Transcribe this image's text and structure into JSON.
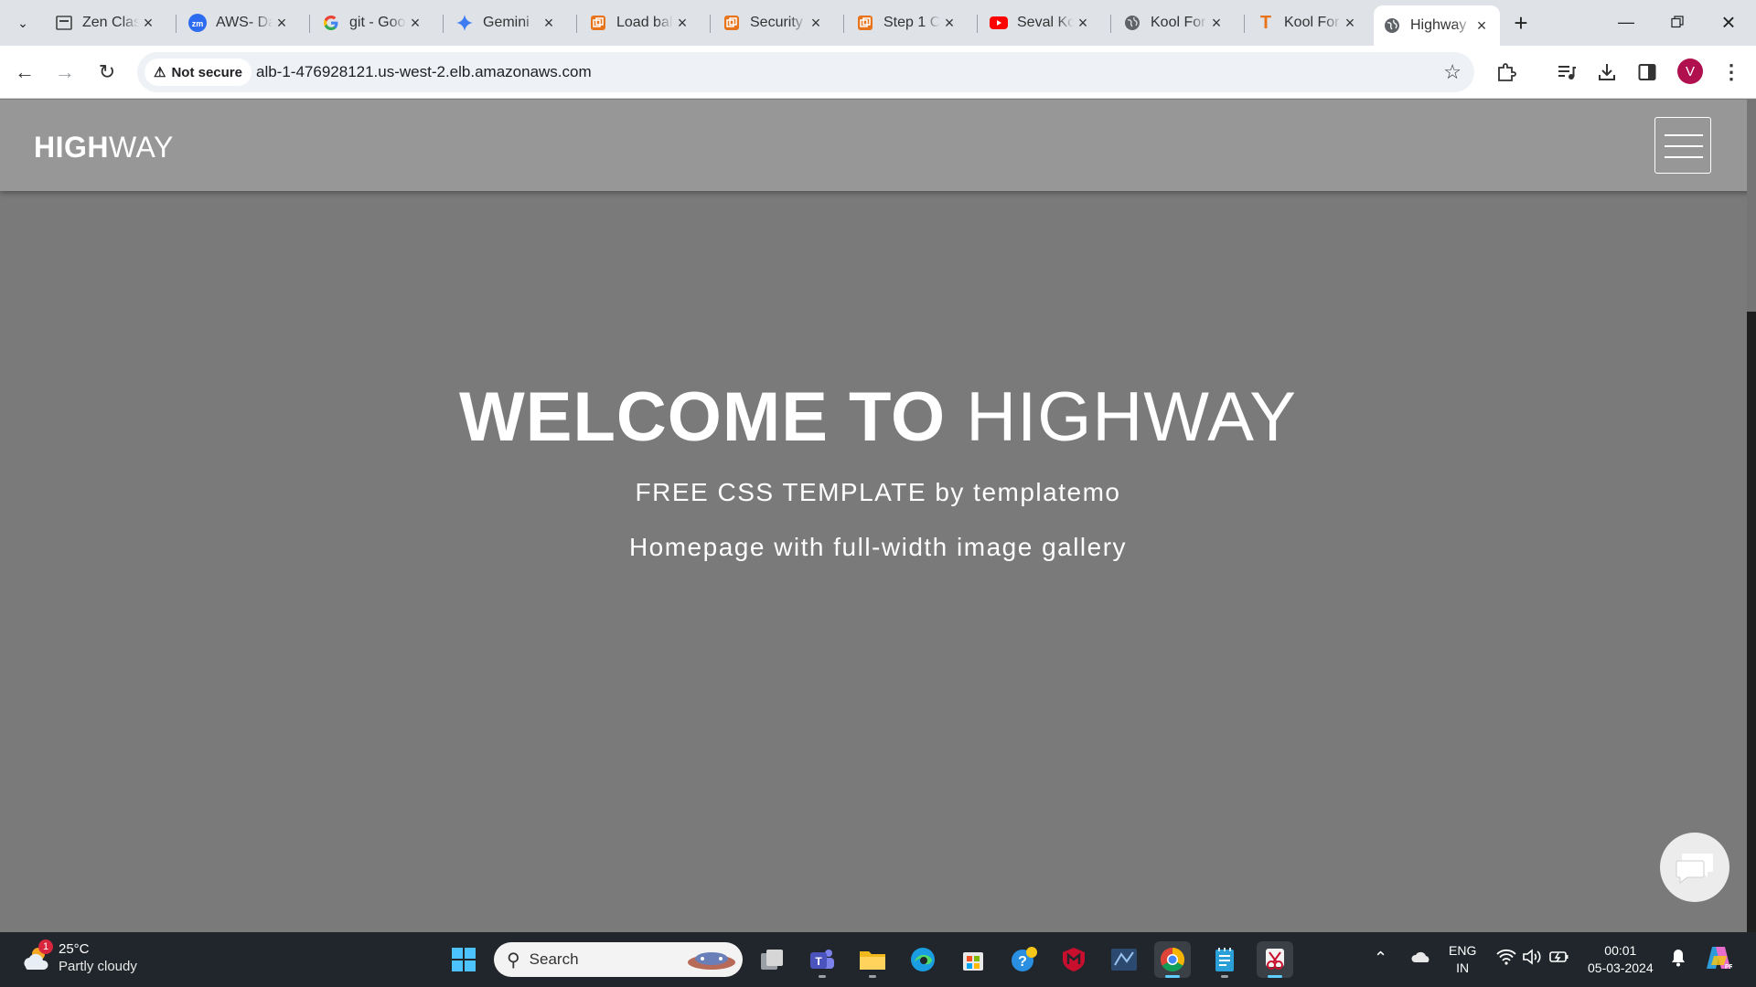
{
  "browser": {
    "tabs": [
      {
        "title": "Zen Class",
        "favicon": "zen-class-icon"
      },
      {
        "title": "AWS- Day",
        "favicon": "zoom-icon"
      },
      {
        "title": "git - Google",
        "favicon": "google-icon"
      },
      {
        "title": "Gemini",
        "favicon": "gemini-icon"
      },
      {
        "title": "Load balancers",
        "favicon": "aws-icon"
      },
      {
        "title": "Security",
        "favicon": "aws-icon"
      },
      {
        "title": "Step 1 C",
        "favicon": "aws-icon"
      },
      {
        "title": "Seval Ko",
        "favicon": "youtube-icon"
      },
      {
        "title": "Kool For",
        "favicon": "globe-icon"
      },
      {
        "title": "Kool For",
        "favicon": "t-icon"
      },
      {
        "title": "Highway",
        "favicon": "globe-icon",
        "active": true
      }
    ],
    "security_label": "Not secure",
    "url": "alb-1-476928121.us-west-2.elb.amazonaws.com",
    "profile_initial": "V"
  },
  "site": {
    "logo_bold": "HIGH",
    "logo_light": "WAY",
    "hero_bold": "WELCOME TO",
    "hero_light": "HIGHWAY",
    "subtitle": "FREE CSS TEMPLATE by templatemo",
    "tagline": "Homepage with full-width image gallery"
  },
  "taskbar": {
    "weather_temp": "25°C",
    "weather_desc": "Partly cloudy",
    "weather_badge": "1",
    "search_placeholder": "Search",
    "lang_line1": "ENG",
    "lang_line2": "IN",
    "time": "00:01",
    "date": "05-03-2024"
  },
  "colors": {
    "accent": "#60cdff",
    "profile": "#b0114e",
    "page_overlay": "#7a7a7a",
    "header_bg": "#979797"
  }
}
